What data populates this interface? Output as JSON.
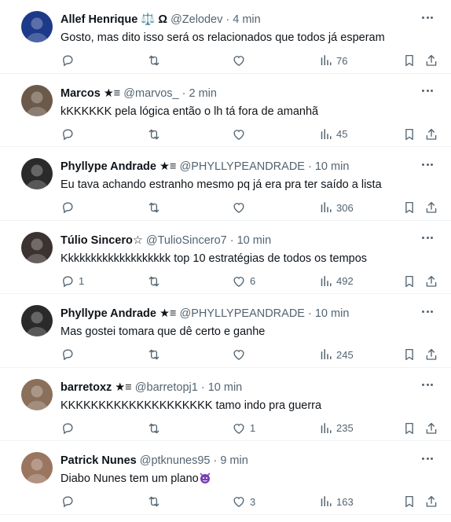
{
  "replies": [
    {
      "name": "Allef Henrique ⚖️ Ω",
      "handle": "@Zelodev",
      "time": "4 min",
      "text": "Gosto, mas dito isso será os relacionados que todos já esperam",
      "reply_count": "",
      "repost_count": "",
      "like_count": "",
      "views": "76",
      "avatar_color": "#1d3a8a"
    },
    {
      "name": "Marcos ★≡",
      "handle": "@marvos_",
      "time": "2 min",
      "text": "kKKKKKK pela lógica então o lh tá fora de amanhã",
      "reply_count": "",
      "repost_count": "",
      "like_count": "",
      "views": "45",
      "avatar_color": "#6b5a4a"
    },
    {
      "name": "Phyllype Andrade ★≡",
      "handle": "@PHYLLYPEANDRADE",
      "time": "10 min",
      "text": "Eu tava achando estranho mesmo pq já era pra ter saído a lista",
      "reply_count": "",
      "repost_count": "",
      "like_count": "",
      "views": "306",
      "avatar_color": "#2a2a2a"
    },
    {
      "name": "Túlio Sincero☆",
      "handle": "@TulioSincero7",
      "time": "10 min",
      "text": "Kkkkkkkkkkkkkkkkkkk top 10 estratégias de todos os tempos",
      "reply_count": "1",
      "repost_count": "",
      "like_count": "6",
      "views": "492",
      "avatar_color": "#3a3330"
    },
    {
      "name": "Phyllype Andrade ★≡",
      "handle": "@PHYLLYPEANDRADE",
      "time": "10 min",
      "text": "Mas gostei tomara que dê certo e ganhe",
      "reply_count": "",
      "repost_count": "",
      "like_count": "",
      "views": "245",
      "avatar_color": "#2a2a2a"
    },
    {
      "name": "barretoxz ★≡",
      "handle": "@barretopj1",
      "time": "10 min",
      "text": "KKKKKKKKKKKKKKKKKKKK tamo indo pra guerra",
      "reply_count": "",
      "repost_count": "",
      "like_count": "1",
      "views": "235",
      "avatar_color": "#8a6f5a"
    },
    {
      "name": "Patrick Nunes",
      "handle": "@ptknunes95",
      "time": "9 min",
      "text": "Diabo Nunes tem um plano",
      "text_emoji": "smiling-imp-emoji",
      "reply_count": "",
      "repost_count": "",
      "like_count": "3",
      "views": "163",
      "avatar_color": "#9a7560"
    }
  ],
  "separator": "·",
  "colors": {
    "text": "#0f1419",
    "secondary": "#536471",
    "divider": "#eff3f4",
    "emoji": "#7b3fb5"
  }
}
